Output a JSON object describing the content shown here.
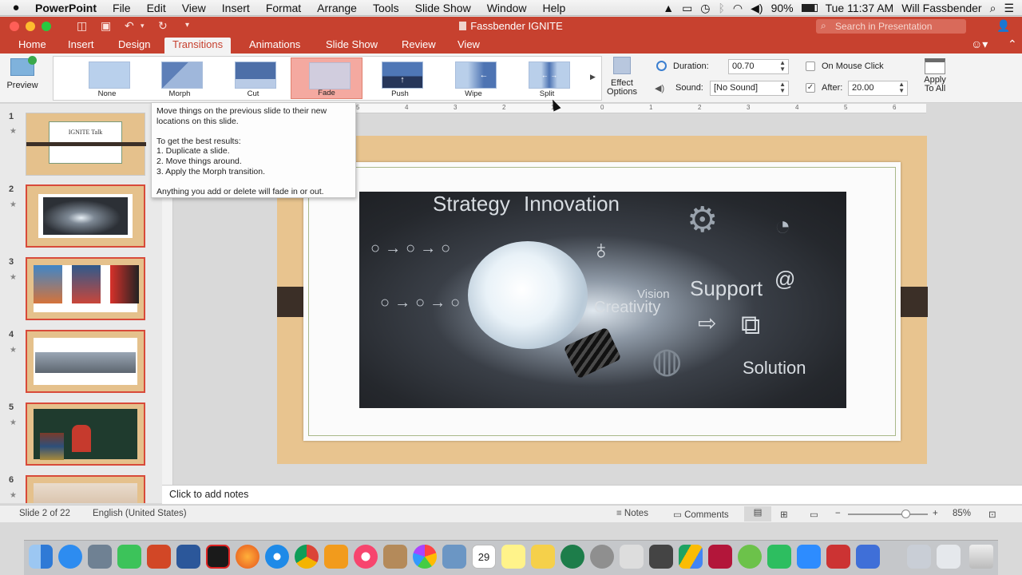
{
  "menubar": {
    "app": "PowerPoint",
    "items": [
      "File",
      "Edit",
      "View",
      "Insert",
      "Format",
      "Arrange",
      "Tools",
      "Slide Show",
      "Window",
      "Help"
    ],
    "battery": "90%",
    "clock": "Tue 11:37 AM",
    "user": "Will Fassbender"
  },
  "window": {
    "title": "Fassbender IGNITE",
    "search_placeholder": "Search in Presentation"
  },
  "ribbon_tabs": [
    "Home",
    "Insert",
    "Design",
    "Transitions",
    "Animations",
    "Slide Show",
    "Review",
    "View"
  ],
  "active_tab": "Transitions",
  "ribbon": {
    "preview_label": "Preview",
    "transitions": [
      "None",
      "Morph",
      "Cut",
      "Fade",
      "Push",
      "Wipe",
      "Split"
    ],
    "selected_transition": "Fade",
    "effect_options": [
      "Effect",
      "Options"
    ],
    "duration_label": "Duration:",
    "duration_value": "00.70",
    "sound_label": "Sound:",
    "sound_value": "[No Sound]",
    "on_mouse_click_label": "On Mouse Click",
    "on_mouse_click_checked": false,
    "after_label": "After:",
    "after_value": "20.00",
    "after_checked": true,
    "apply_all": [
      "Apply",
      "To All"
    ]
  },
  "tooltip": {
    "lines": [
      "Move things on the previous slide to their new",
      "locations on this slide.",
      "",
      "To get the best results:",
      "1. Duplicate a slide.",
      "2. Move things around.",
      "3. Apply the Morph transition.",
      "",
      "Anything you add or delete will fade in or out."
    ]
  },
  "slides": [
    {
      "number": "1",
      "caption": "IGNITE Talk",
      "selected": false
    },
    {
      "number": "2",
      "selected": true
    },
    {
      "number": "3",
      "selected": false
    },
    {
      "number": "4",
      "selected": false
    },
    {
      "number": "5",
      "selected": false
    },
    {
      "number": "6",
      "selected": false
    }
  ],
  "ruler_labels": [
    "5",
    "4",
    "3",
    "2",
    "1",
    "0",
    "1",
    "2",
    "3",
    "4",
    "5",
    "6"
  ],
  "slide_image_words": {
    "strategy": "Strategy",
    "innovation": "Innovation",
    "vision": "Vision",
    "creativity": "Creativity",
    "support": "Support",
    "solution": "Solution"
  },
  "notes_placeholder": "Click to add notes",
  "status": {
    "slide_of": "Slide 2 of 22",
    "language": "English (United States)",
    "notes_label": "Notes",
    "comments_label": "Comments",
    "zoom": "85%",
    "zoom_fraction": 0.75
  },
  "dock_calendar_day": "29",
  "colors": {
    "brand": "#c7412f",
    "selected_transition": "#f4a9a0",
    "slide_wood": "#e8c48f"
  }
}
